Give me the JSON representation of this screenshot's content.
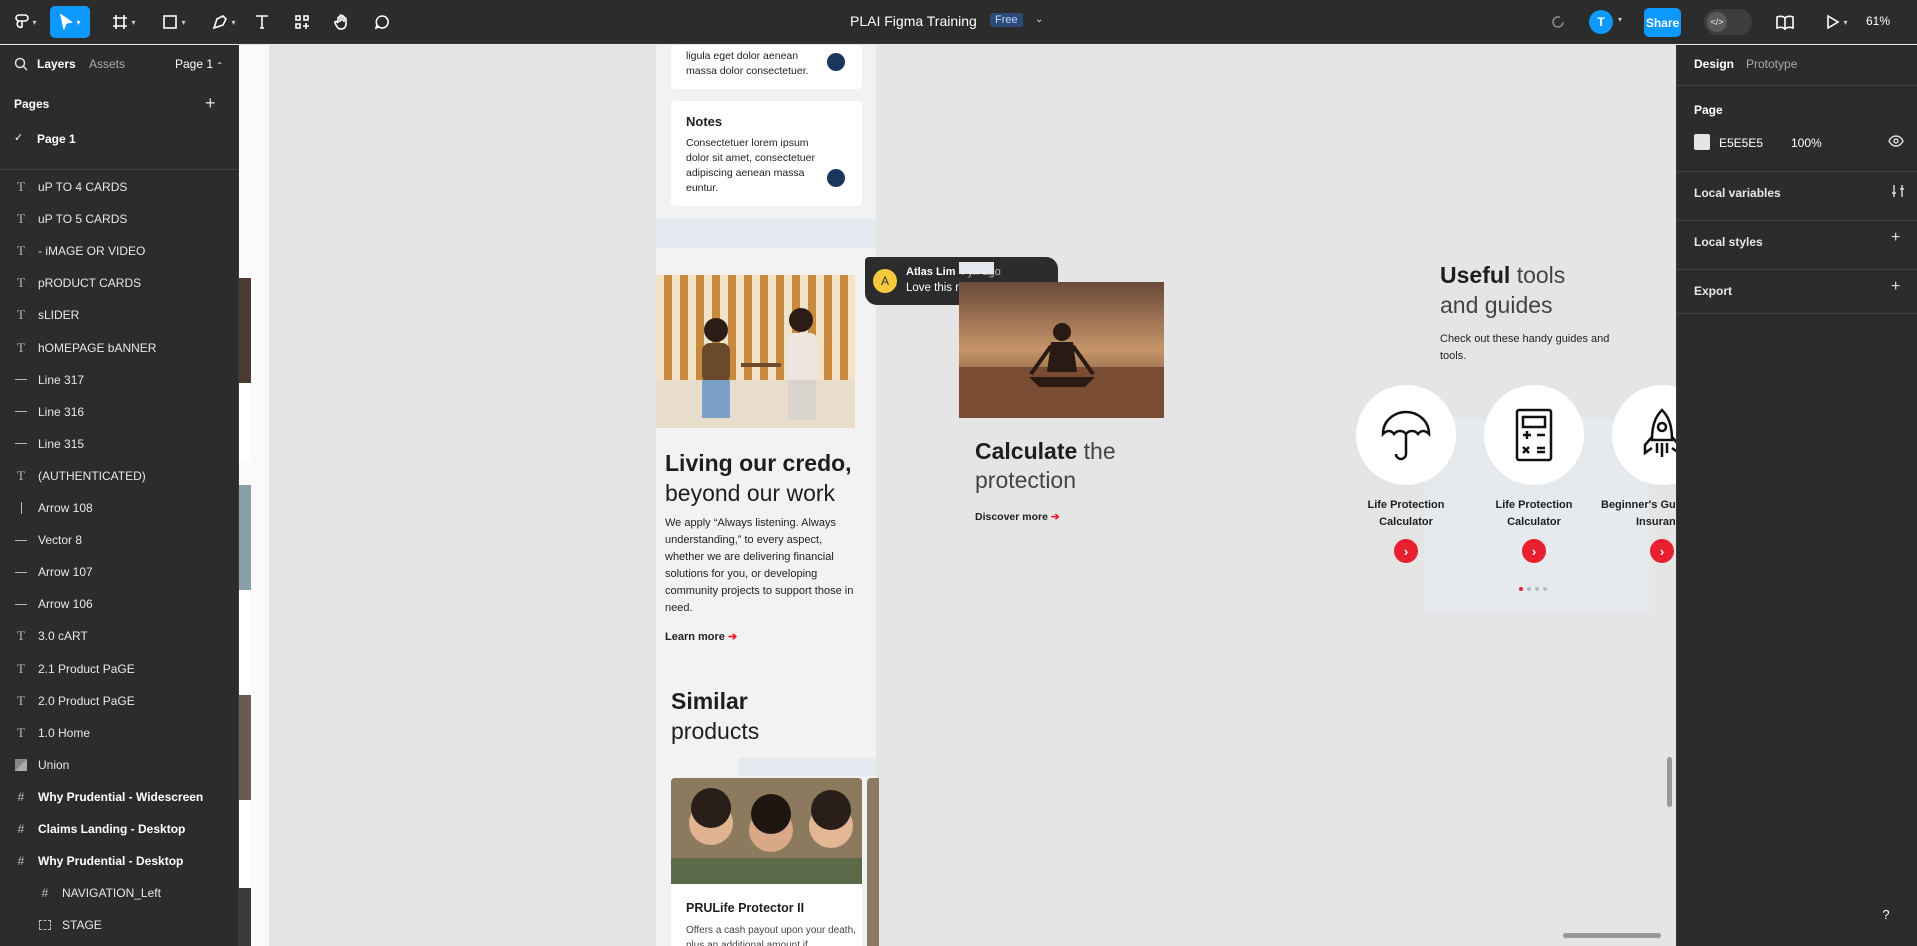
{
  "toolbar": {
    "file_title": "PLAI Figma Training",
    "plan_badge": "Free",
    "avatar_initial": "T",
    "share_label": "Share",
    "zoom": "61%",
    "icons": [
      "figma-menu-icon",
      "move-tool-icon",
      "frame-tool-icon",
      "shape-tool-icon",
      "pen-tool-icon",
      "text-tool-icon",
      "resources-icon",
      "hand-tool-icon",
      "comment-tool-icon",
      "sync-status-icon",
      "dev-mode-icon",
      "library-icon",
      "present-icon"
    ]
  },
  "left_panel": {
    "tabs": [
      "Layers",
      "Assets"
    ],
    "page_select": "Page 1",
    "pages_title": "Pages",
    "current_page": "Page 1",
    "layers": [
      {
        "label": "uP TO 4 CARDS",
        "kind": "text"
      },
      {
        "label": "uP TO 5 CARDS",
        "kind": "text"
      },
      {
        "label": "- iMAGE OR VIDEO",
        "kind": "text"
      },
      {
        "label": "pRODUCT CARDS",
        "kind": "text"
      },
      {
        "label": "sLIDER",
        "kind": "text"
      },
      {
        "label": "hOMEPAGE bANNER",
        "kind": "text"
      },
      {
        "label": "Line 317",
        "kind": "line"
      },
      {
        "label": "Line 316",
        "kind": "line"
      },
      {
        "label": "Line 315",
        "kind": "line"
      },
      {
        "label": "(AUTHENTICATED)",
        "kind": "text"
      },
      {
        "label": "Arrow 108",
        "kind": "vline"
      },
      {
        "label": "Vector 8",
        "kind": "line"
      },
      {
        "label": "Arrow 107",
        "kind": "line"
      },
      {
        "label": "Arrow 106",
        "kind": "line"
      },
      {
        "label": "3.0 cART",
        "kind": "text"
      },
      {
        "label": "2.1 Product PaGE",
        "kind": "text"
      },
      {
        "label": "2.0 Product PaGE",
        "kind": "text"
      },
      {
        "label": "1.0 Home",
        "kind": "text"
      },
      {
        "label": "Union",
        "kind": "union"
      },
      {
        "label": "Why Prudential - Widescreen",
        "kind": "frame"
      },
      {
        "label": "Claims Landing - Desktop",
        "kind": "frame"
      },
      {
        "label": "Why Prudential - Desktop",
        "kind": "frame"
      },
      {
        "label": "NAVIGATION_Left",
        "kind": "child-frame"
      },
      {
        "label": "STAGE",
        "kind": "child-section"
      }
    ]
  },
  "right_panel": {
    "tabs": [
      "Design",
      "Prototype"
    ],
    "page_title": "Page",
    "bg_hex": "E5E5E5",
    "bg_opacity": "100%",
    "local_variables": "Local variables",
    "local_styles": "Local styles",
    "export": "Export"
  },
  "canvas": {
    "card1_text": "ligula eget dolor aenean massa dolor consectetuer.",
    "notes_title": "Notes",
    "notes_body": "Consectetuer lorem ipsum dolor sit amet, consectetuer adipiscing aenean massa euntur.",
    "credo_bold": "Living our credo,",
    "credo_light": "beyond our work",
    "credo_body": "We apply “Always listening. Always understanding,” to every aspect, whether we are delivering financial solutions for you, or developing community projects to support those in need.",
    "learn_more": "Learn more",
    "similar_bold": "Similar",
    "similar_light": "products",
    "product_title": "PRULife Protector II",
    "product_desc": "Offers a cash payout upon your death, plus an additional amount if",
    "comment_author": "Atlas Lim",
    "comment_time": "4 yr. ago",
    "comment_text": "Love this new component.",
    "comment_avatar": "A",
    "calc_bold": "Calculate",
    "calc_light1": "the",
    "calc_light2": "protection",
    "discover_more": "Discover more",
    "tools_bold": "Useful",
    "tools_light1": "tools",
    "tools_light2": "and guides",
    "tools_body": "Check out these handy guides and tools.",
    "tools": [
      {
        "label1": "Life Protection",
        "label2": "Calculator",
        "icon": "umbrella-icon"
      },
      {
        "label1": "Life Protection",
        "label2": "Calculator",
        "icon": "calculator-icon"
      },
      {
        "label1": "Beginner's Guid",
        "label2": "Insuranc",
        "icon": "rocket-icon"
      }
    ]
  },
  "colors": {
    "accent": "#0d99ff",
    "brand_red": "#ed1b2e",
    "navy": "#1b365d",
    "canvas_bg": "#e5e5e5"
  }
}
